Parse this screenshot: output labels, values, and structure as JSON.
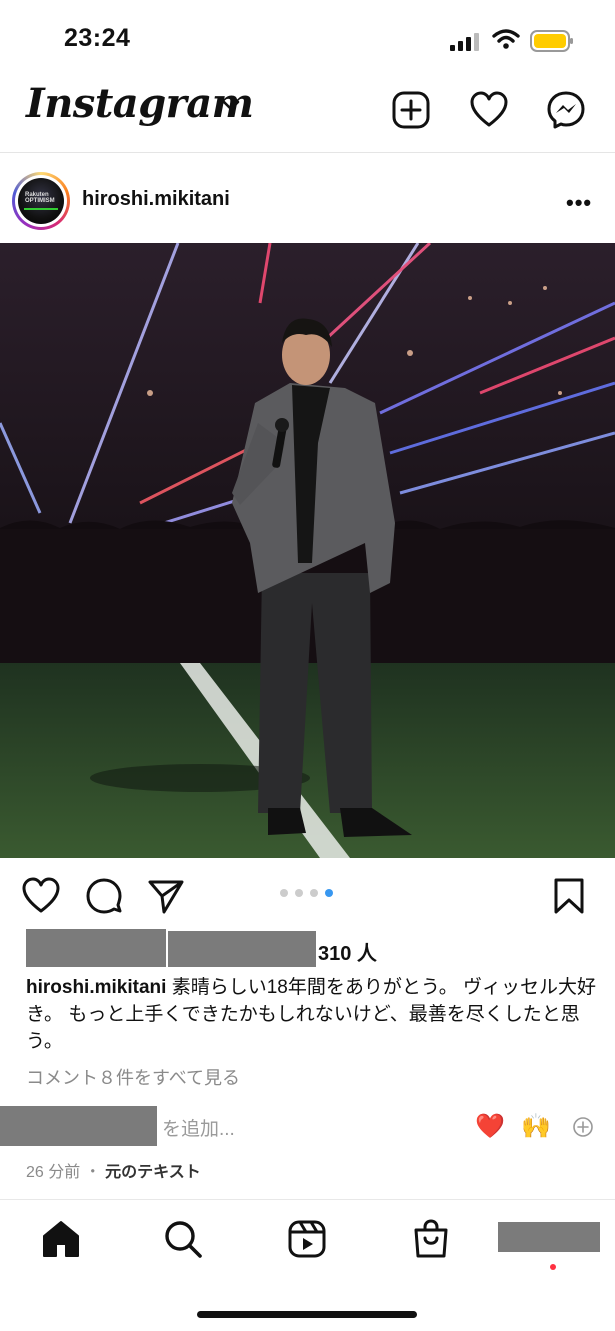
{
  "status_bar": {
    "time": "23:24"
  },
  "header": {
    "logo": "Instagram"
  },
  "post": {
    "username": "hiroshi.mikitani",
    "avatar_label": "Rakuten OPTIMISM",
    "likes_text": "310 人",
    "caption_user": "hiroshi.mikitani",
    "caption_text": " 素晴らしい18年間をありがとう。 ヴィッセル大好き。 もっと上手くできたかもしれないけど、最善を尽くしたと思う。",
    "view_all_comments": "コメント８件をすべて見る",
    "add_comment_placeholder": "を追加...",
    "reaction_heart": "❤️",
    "reaction_clap": "🙌",
    "time_ago": "26 分前",
    "separator": "・",
    "see_original": "元のテキスト",
    "carousel": {
      "count": 4,
      "active_index": 3
    }
  },
  "colors": {
    "accent_blue": "#3897f0",
    "heart_red": "#ed4956"
  }
}
